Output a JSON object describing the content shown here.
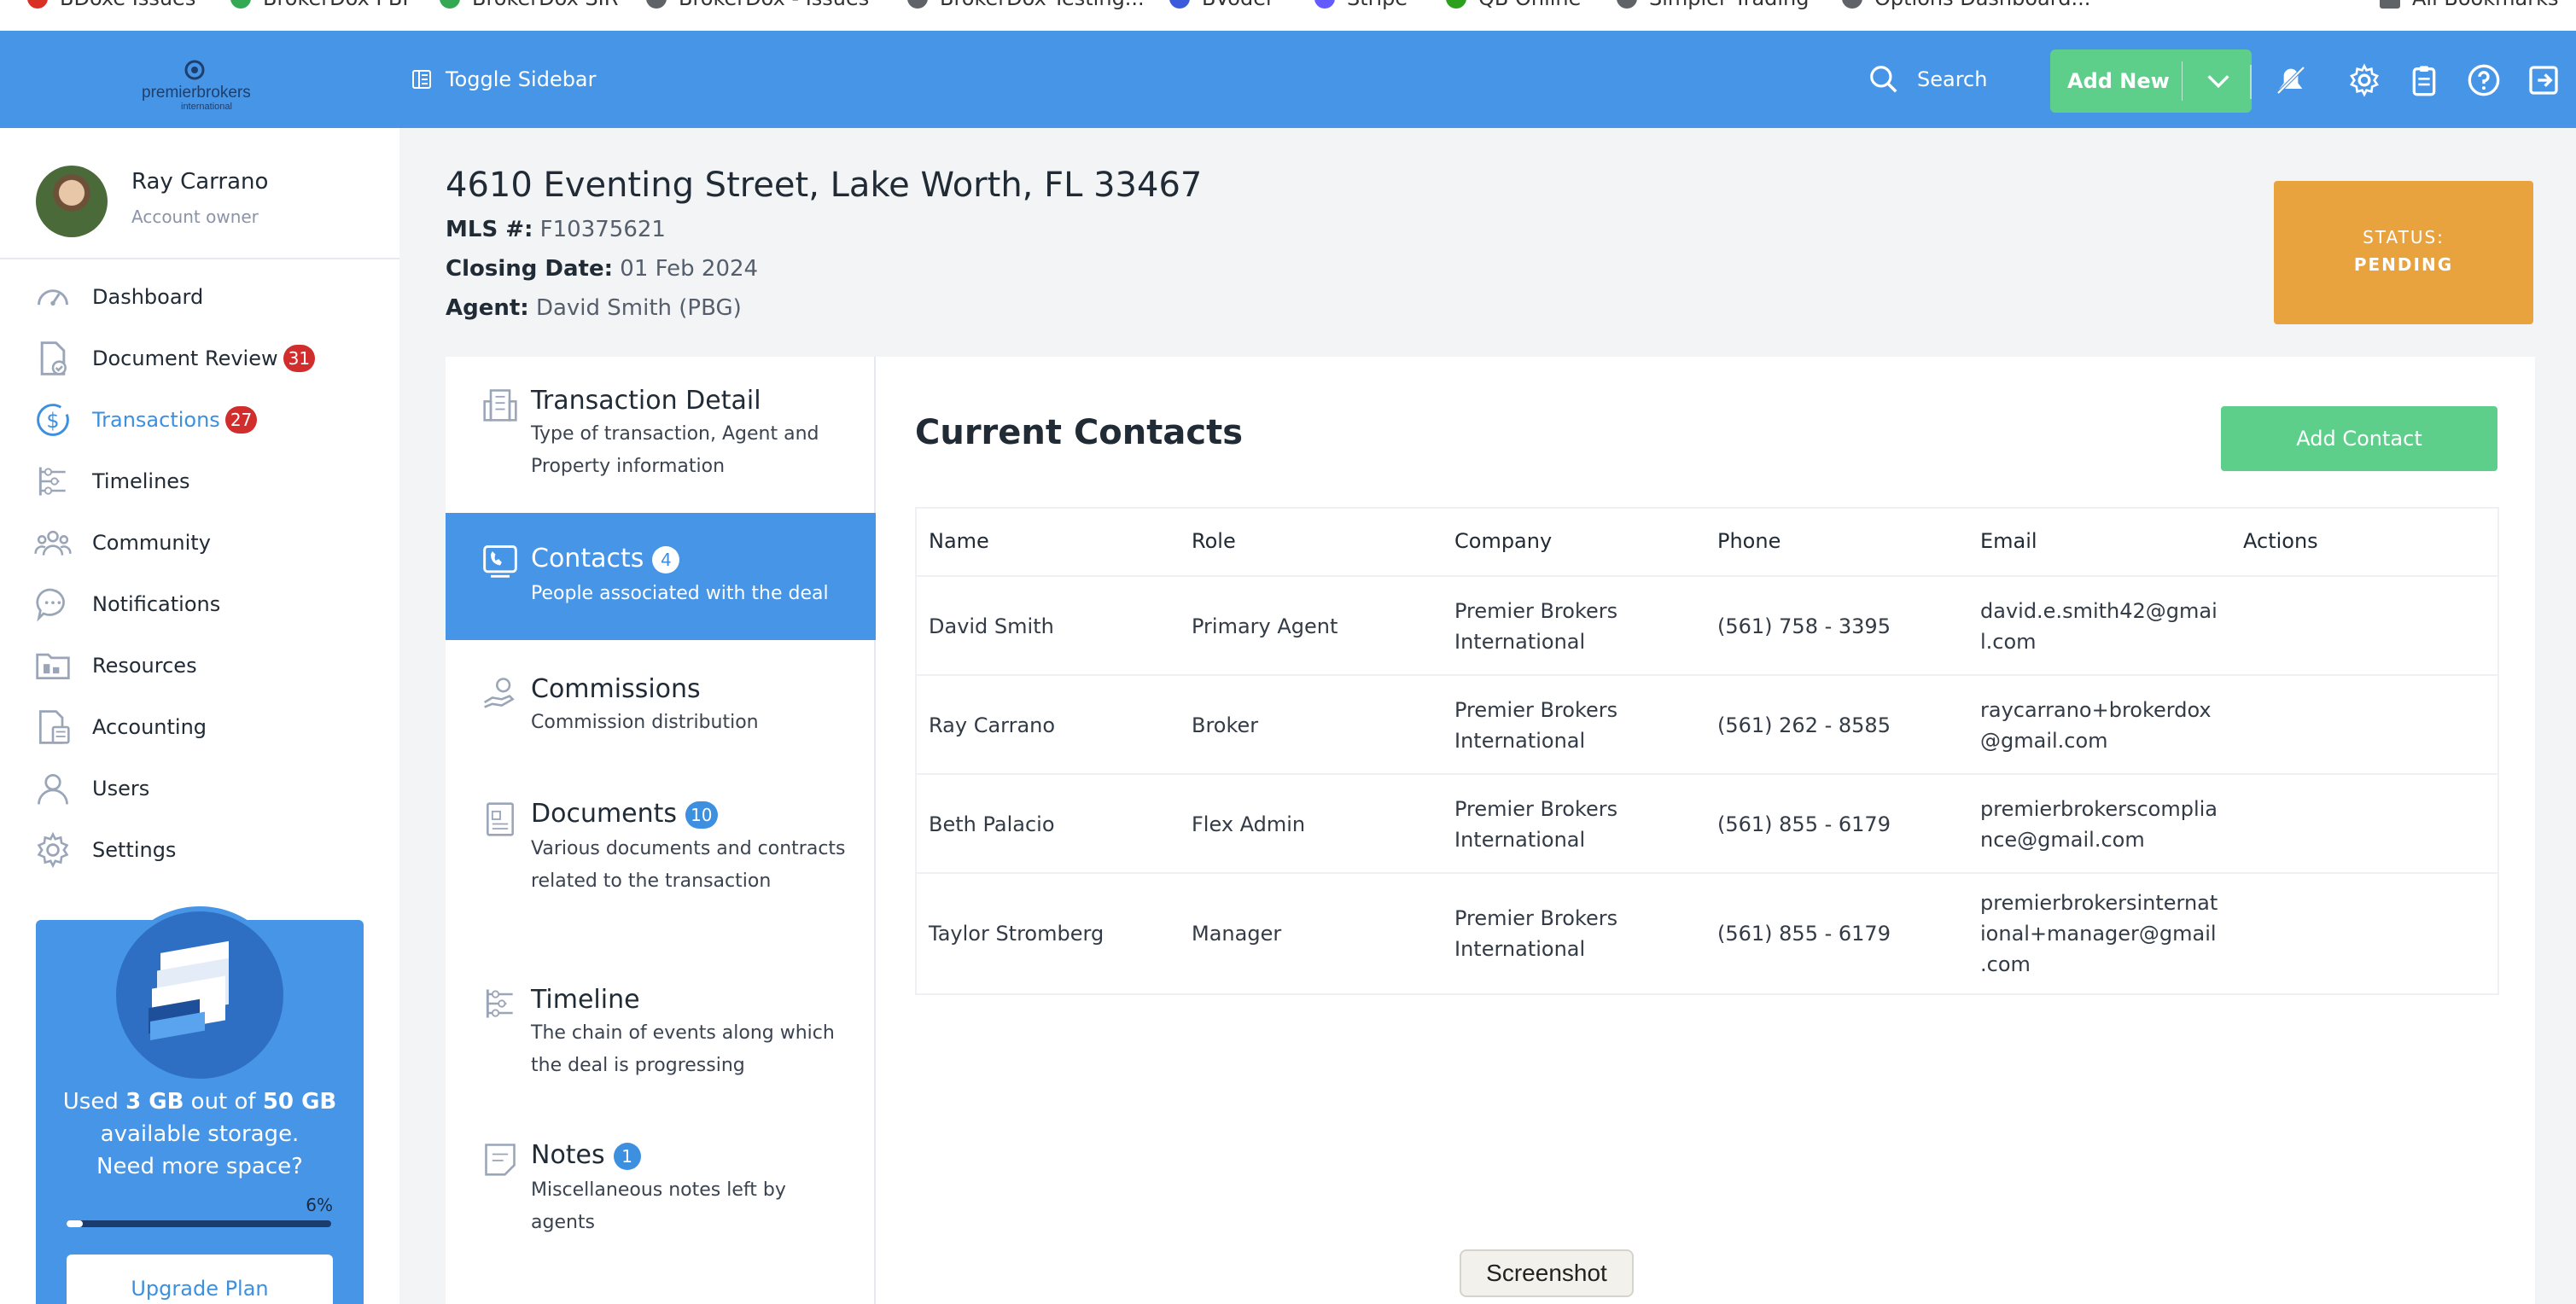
{
  "bookmarks": [
    {
      "label": "BDoxe Issues",
      "color": "#d93025"
    },
    {
      "label": "BrokerDox PBI",
      "color": "#34a853"
    },
    {
      "label": "BrokerDox SIR",
      "color": "#34a853"
    },
    {
      "label": "BrokerDox - Issues",
      "color": "#5f6368"
    },
    {
      "label": "BrokerDox Testing...",
      "color": "#5f6368"
    },
    {
      "label": "BVoder",
      "color": "#3b5bdb"
    },
    {
      "label": "Stripe",
      "color": "#635bff"
    },
    {
      "label": "QB Online",
      "color": "#2ca01c"
    },
    {
      "label": "Simpler Trading",
      "color": "#5f6368"
    },
    {
      "label": "Options Dashboard...",
      "color": "#5f6368"
    },
    {
      "label": "All Bookmarks",
      "color": "#5f6368"
    }
  ],
  "header": {
    "logo_text": "premierbrokers",
    "logo_sub": "international",
    "toggle_label": "Toggle Sidebar",
    "search_label": "Search",
    "add_new_label": "Add New"
  },
  "profile": {
    "name": "Ray Carrano",
    "role": "Account owner"
  },
  "nav": {
    "items": [
      {
        "label": "Dashboard",
        "icon": "dashboard-icon",
        "badge": ""
      },
      {
        "label": "Document Review",
        "icon": "document-review-icon",
        "badge": "31"
      },
      {
        "label": "Transactions",
        "icon": "dollar-icon",
        "badge": "27"
      },
      {
        "label": "Timelines",
        "icon": "timeline-icon",
        "badge": ""
      },
      {
        "label": "Community",
        "icon": "community-icon",
        "badge": ""
      },
      {
        "label": "Notifications",
        "icon": "chat-bubble-icon",
        "badge": ""
      },
      {
        "label": "Resources",
        "icon": "folder-icon",
        "badge": ""
      },
      {
        "label": "Accounting",
        "icon": "accounting-icon",
        "badge": ""
      },
      {
        "label": "Users",
        "icon": "user-icon",
        "badge": ""
      },
      {
        "label": "Settings",
        "icon": "gear-icon",
        "badge": ""
      }
    ]
  },
  "storage": {
    "line1_prefix": "Used ",
    "used": "3 GB",
    "line1_mid": " out of ",
    "total": "50 GB",
    "line2": "available storage.",
    "line3": "Need more space?",
    "percent_label": "6%",
    "percent": 0.06,
    "upgrade_label": "Upgrade Plan"
  },
  "transaction": {
    "address": "4610 Eventing Street, Lake Worth, FL 33467",
    "mls_label": "MLS #:",
    "mls": "F10375621",
    "closing_label": "Closing Date:",
    "closing": "01 Feb 2024",
    "agent_label": "Agent:",
    "agent": "David Smith (PBG)",
    "status_label": "STATUS:",
    "status": "PENDING"
  },
  "tabs": [
    {
      "title": "Transaction Detail",
      "badge": "",
      "desc": "Type of transaction, Agent and Property information",
      "icon": "building-icon"
    },
    {
      "title": "Contacts",
      "badge": "4",
      "desc": "People associated with the deal",
      "icon": "contacts-icon"
    },
    {
      "title": "Commissions",
      "badge": "",
      "desc": "Commission distribution",
      "icon": "hand-coin-icon"
    },
    {
      "title": "Documents",
      "badge": "10",
      "desc": "Various documents and contracts related to the transaction",
      "icon": "document-icon"
    },
    {
      "title": "Timeline",
      "badge": "",
      "desc": "The chain of events along which the deal is progressing",
      "icon": "timeline-icon"
    },
    {
      "title": "Notes",
      "badge": "1",
      "desc": "Miscellaneous notes left by agents",
      "icon": "notes-icon"
    }
  ],
  "contacts": {
    "title": "Current Contacts",
    "add_label": "Add Contact",
    "columns": [
      "Name",
      "Role",
      "Company",
      "Phone",
      "Email",
      "Actions"
    ],
    "rows": [
      {
        "name": "David Smith",
        "role": "Primary Agent",
        "company_l1": "Premier Brokers",
        "company_l2": "International",
        "phone": "(561) 758 - 3395",
        "email_l1": "david.e.smith42@gmai",
        "email_l2": "l.com",
        "email_l3": ""
      },
      {
        "name": "Ray Carrano",
        "role": "Broker",
        "company_l1": "Premier Brokers",
        "company_l2": "International",
        "phone": "(561) 262 - 8585",
        "email_l1": "raycarrano+brokerdox",
        "email_l2": "@gmail.com",
        "email_l3": ""
      },
      {
        "name": "Beth Palacio",
        "role": "Flex Admin",
        "company_l1": "Premier Brokers",
        "company_l2": "International",
        "phone": "(561) 855 - 6179",
        "email_l1": "premierbrokerscomplia",
        "email_l2": "nce@gmail.com",
        "email_l3": ""
      },
      {
        "name": "Taylor Stromberg",
        "role": "Manager",
        "company_l1": "Premier Brokers",
        "company_l2": "International",
        "phone": "(561) 855 - 6179",
        "email_l1": "premierbrokersinternat",
        "email_l2": "ional+manager@gmail",
        "email_l3": ".com"
      }
    ]
  },
  "tooltip": {
    "label": "Screenshot"
  },
  "colors": {
    "primary": "#4795e6",
    "success": "#5ecf8b",
    "warning": "#e8a33f",
    "badge_red": "#d12d2d"
  }
}
